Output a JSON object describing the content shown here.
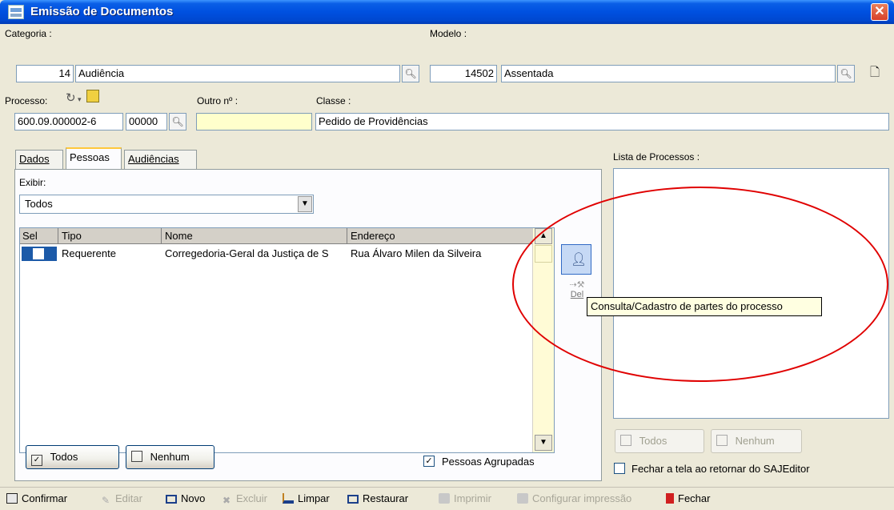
{
  "window": {
    "title": "Emissão de Documentos",
    "close_glyph": "✕"
  },
  "categoria": {
    "label": "Categoria :",
    "code": "14",
    "name": "Audiência"
  },
  "modelo": {
    "label": "Modelo :",
    "code": "14502",
    "name": "Assentada"
  },
  "processo": {
    "label": "Processo:",
    "numero": "600.09.000002-6",
    "sufixo": "00000"
  },
  "outro": {
    "label": "Outro nº :",
    "value": ""
  },
  "classe": {
    "label": "Classe :",
    "value": "Pedido de Providências"
  },
  "tabs": [
    {
      "label": "Dados"
    },
    {
      "label": "Pessoas"
    },
    {
      "label": "Audiências"
    }
  ],
  "exibir": {
    "label": "Exibir:",
    "selected": "Todos"
  },
  "grid": {
    "columns": [
      "Sel",
      "Tipo",
      "Nome",
      "Endereço"
    ],
    "rows": [
      {
        "sel": "",
        "tipo": "Requerente",
        "nome": "Corregedoria-Geral da Justiça de S",
        "endereco": "Rua Álvaro Milen da Silveira"
      }
    ]
  },
  "side_buttons": {
    "del_label": "Del"
  },
  "tooltip": "Consulta/Cadastro de partes do processo",
  "left_buttons": {
    "todos": "Todos",
    "nenhum": "Nenhum"
  },
  "pessoas_agrupadas": {
    "label": "Pessoas Agrupadas",
    "checked": true
  },
  "lista": {
    "label": "Lista de Processos :",
    "todos": "Todos",
    "nenhum": "Nenhum",
    "fechar_label": "Fechar a tela ao retornar do SAJEditor"
  },
  "toolbar": {
    "confirmar": "Confirmar",
    "editar": "Editar",
    "novo": "Novo",
    "excluir": "Excluir",
    "limpar": "Limpar",
    "restaurar": "Restaurar",
    "imprimir": "Imprimir",
    "configurar": "Configurar impressão",
    "fechar": "Fechar"
  },
  "colors": {
    "title_bar": "#0050e0",
    "annotation": "#e00000",
    "tooltip_bg": "#ffffe1"
  }
}
